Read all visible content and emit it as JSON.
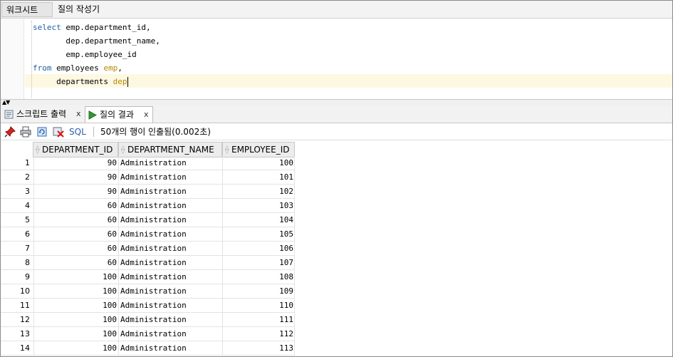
{
  "top_tabs": {
    "worksheet": "워크시트",
    "query_builder": "질의 작성기"
  },
  "editor": {
    "lines": [
      {
        "kw": "select",
        "text": " emp.department_id,",
        "alias": "",
        "pre": ""
      },
      {
        "kw": "",
        "text": "dep.department_name,",
        "alias": "",
        "pre": "       "
      },
      {
        "kw": "",
        "text": "emp.employee_id",
        "alias": "",
        "pre": "       "
      },
      {
        "kw": "from",
        "text": " employees ",
        "alias": "emp",
        "tail": ",",
        "pre": ""
      },
      {
        "kw": "",
        "text": "departments ",
        "alias": "dep",
        "pre": "     "
      }
    ]
  },
  "result_tabs": {
    "script_output": "스크립트 출력",
    "query_result": "질의 결과",
    "close": "x"
  },
  "toolbar": {
    "sql_label": "SQL",
    "status": "50개의 행이 인출됨(0.002초)"
  },
  "grid": {
    "columns": [
      "DEPARTMENT_ID",
      "DEPARTMENT_NAME",
      "EMPLOYEE_ID"
    ],
    "rows": [
      {
        "n": "1",
        "dept": "90",
        "name": "Administration",
        "emp": "100"
      },
      {
        "n": "2",
        "dept": "90",
        "name": "Administration",
        "emp": "101"
      },
      {
        "n": "3",
        "dept": "90",
        "name": "Administration",
        "emp": "102"
      },
      {
        "n": "4",
        "dept": "60",
        "name": "Administration",
        "emp": "103"
      },
      {
        "n": "5",
        "dept": "60",
        "name": "Administration",
        "emp": "104"
      },
      {
        "n": "6",
        "dept": "60",
        "name": "Administration",
        "emp": "105"
      },
      {
        "n": "7",
        "dept": "60",
        "name": "Administration",
        "emp": "106"
      },
      {
        "n": "8",
        "dept": "60",
        "name": "Administration",
        "emp": "107"
      },
      {
        "n": "9",
        "dept": "100",
        "name": "Administration",
        "emp": "108"
      },
      {
        "n": "10",
        "dept": "100",
        "name": "Administration",
        "emp": "109"
      },
      {
        "n": "11",
        "dept": "100",
        "name": "Administration",
        "emp": "110"
      },
      {
        "n": "12",
        "dept": "100",
        "name": "Administration",
        "emp": "111"
      },
      {
        "n": "13",
        "dept": "100",
        "name": "Administration",
        "emp": "112"
      },
      {
        "n": "14",
        "dept": "100",
        "name": "Administration",
        "emp": "113"
      }
    ]
  },
  "colors": {
    "keyword": "#1f5fa8",
    "alias": "#b58a00",
    "current_line": "#fdf8e2",
    "run_icon": "#2e9b2e"
  }
}
